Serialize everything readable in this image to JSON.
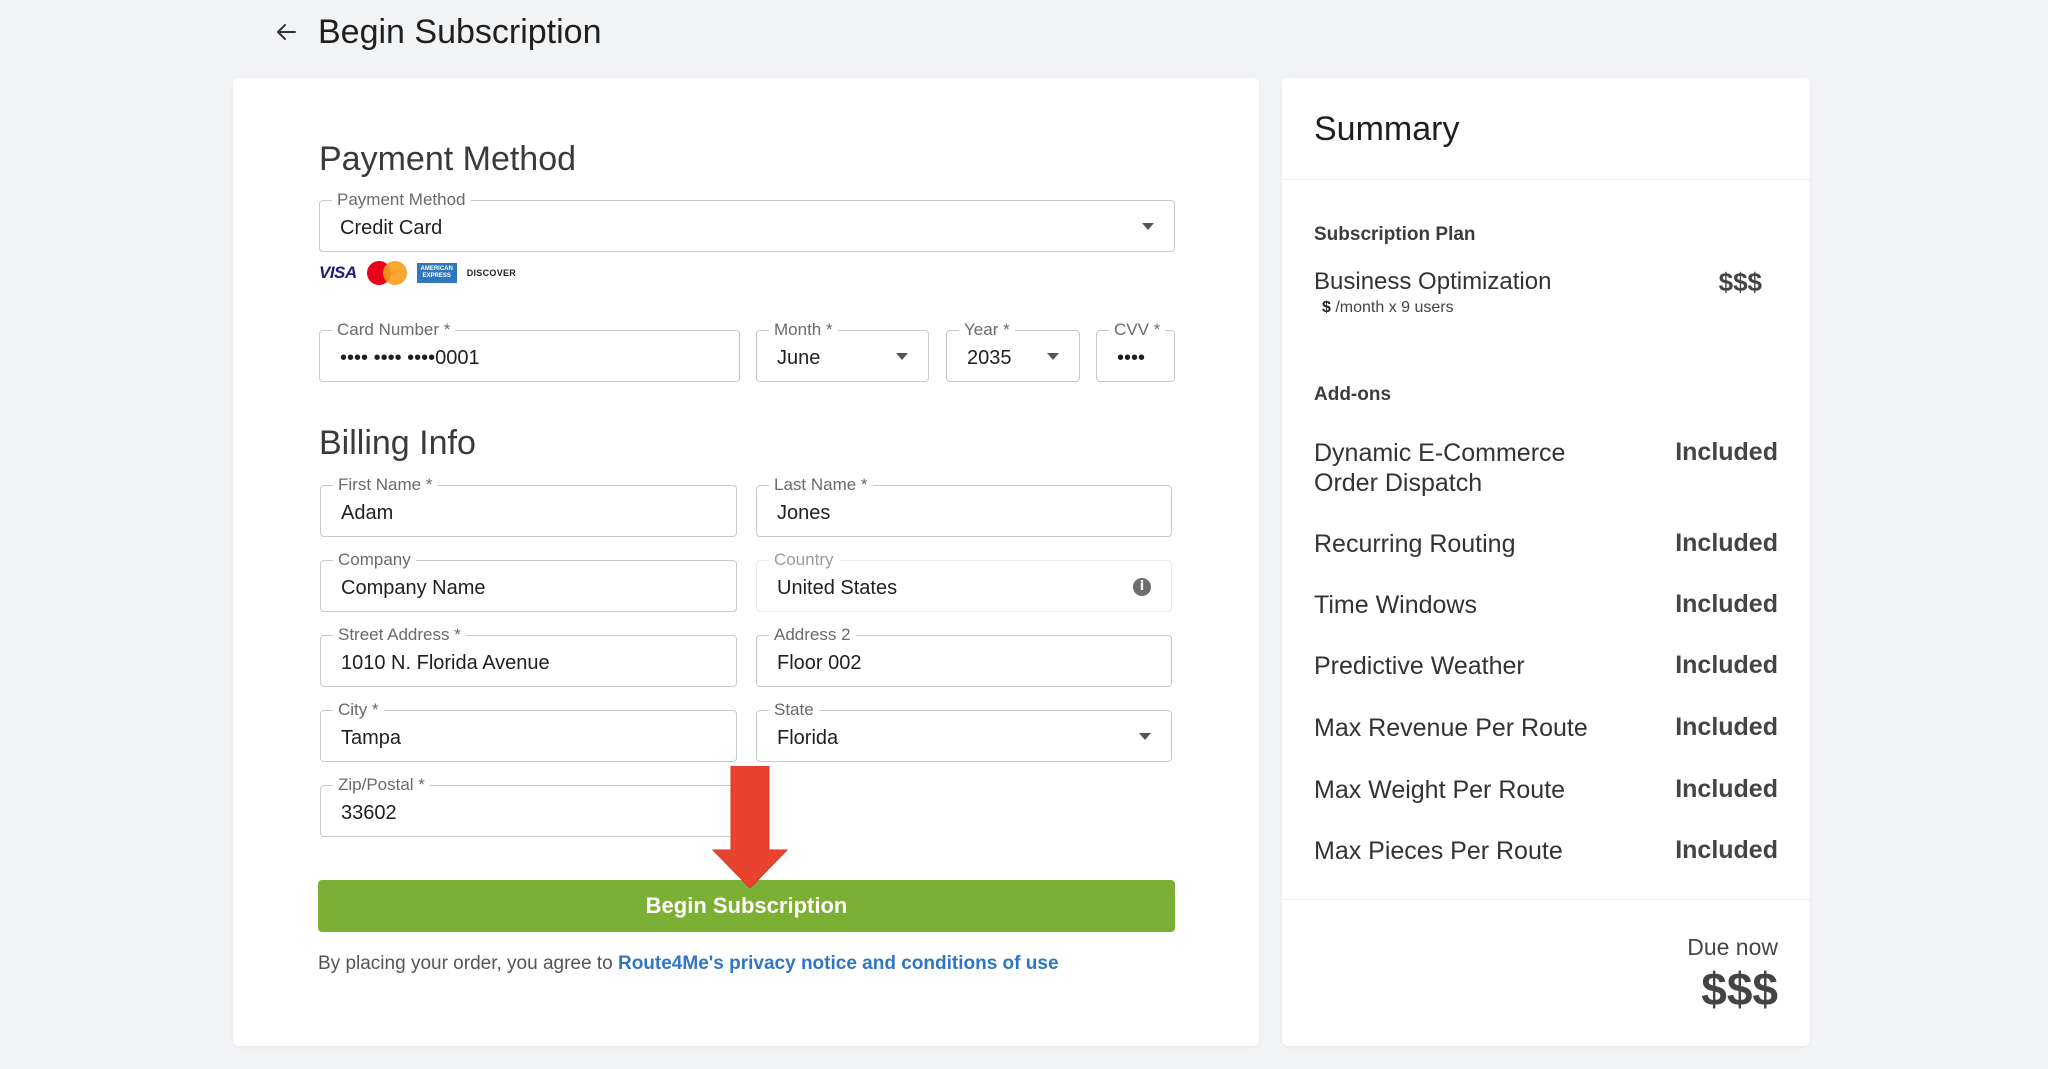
{
  "header": {
    "title": "Begin Subscription"
  },
  "payment": {
    "section_title": "Payment Method",
    "method": {
      "label": "Payment Method",
      "value": "Credit Card"
    },
    "card_logos": [
      "VISA",
      "MasterCard",
      "AMERICAN EXPRESS",
      "DISCOVER"
    ],
    "card_number": {
      "label": "Card Number *",
      "value": "•••• •••• ••••0001"
    },
    "month": {
      "label": "Month *",
      "value": "June"
    },
    "year": {
      "label": "Year *",
      "value": "2035"
    },
    "cvv": {
      "label": "CVV *",
      "value": "••••"
    }
  },
  "billing": {
    "section_title": "Billing Info",
    "first_name": {
      "label": "First Name *",
      "value": "Adam"
    },
    "last_name": {
      "label": "Last Name *",
      "value": "Jones"
    },
    "company": {
      "label": "Company",
      "value": "Company Name"
    },
    "country": {
      "label": "Country",
      "value": "United States"
    },
    "street": {
      "label": "Street Address *",
      "value": "1010 N. Florida Avenue"
    },
    "address2": {
      "label": "Address 2",
      "value": "Floor 002"
    },
    "city": {
      "label": "City *",
      "value": "Tampa"
    },
    "state": {
      "label": "State",
      "value": "Florida"
    },
    "zip": {
      "label": "Zip/Postal *",
      "value": "33602"
    }
  },
  "submit": {
    "label": "Begin Subscription"
  },
  "agreement": {
    "text": "By placing your order, you agree to ",
    "link": "Route4Me's privacy notice and conditions of use"
  },
  "summary": {
    "title": "Summary",
    "plan_label": "Subscription Plan",
    "plan_name": "Business Optimization",
    "plan_sub_currency": "$",
    "plan_sub_rest": " /month x 9 users",
    "plan_price": "$$$",
    "addons_label": "Add-ons",
    "addons": [
      {
        "name": "Dynamic E-Commerce Order Dispatch",
        "value": "Included"
      },
      {
        "name": "Recurring Routing",
        "value": "Included"
      },
      {
        "name": "Time Windows",
        "value": "Included"
      },
      {
        "name": "Predictive Weather",
        "value": "Included"
      },
      {
        "name": "Max Revenue Per Route",
        "value": "Included"
      },
      {
        "name": "Max Weight Per Route",
        "value": "Included"
      },
      {
        "name": "Max Pieces Per Route",
        "value": "Included"
      }
    ],
    "due_label": "Due now",
    "due_amount": "$$$"
  },
  "colors": {
    "accent_green": "#7cb035",
    "link_blue": "#2f76c3",
    "annotation_red": "#e8432f"
  },
  "icons": {
    "back": "arrow-left-icon",
    "dropdown": "chevron-down-icon",
    "info": "info-icon",
    "annotation": "red-down-arrow"
  }
}
